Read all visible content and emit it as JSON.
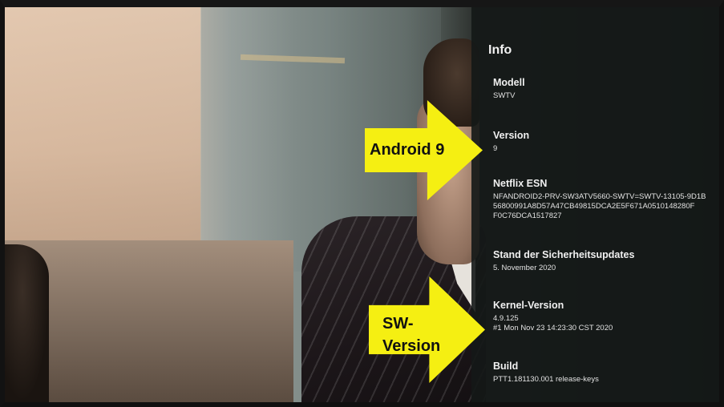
{
  "panel": {
    "title": "Info",
    "items": [
      {
        "label": "Modell",
        "value": "SWTV"
      },
      {
        "label": "Version",
        "value": "9"
      },
      {
        "label": "Netflix ESN",
        "value": "NFANDROID2-PRV-SW3ATV5660-SWTV=SWTV-13105-9D1B\n56800991A8D57A47CB49815DCA2E5F671A0510148280F\nF0C76DCA1517827"
      },
      {
        "label": "Stand der Sicherheitsupdates",
        "value": "5. November 2020"
      },
      {
        "label": "Kernel-Version",
        "value": "4.9.125\n#1 Mon Nov 23 14:23:30 CST 2020"
      },
      {
        "label": "Build",
        "value": "PTT1.181130.001 release-keys"
      }
    ]
  },
  "annotations": {
    "arrow1_text": "Android 9",
    "arrow2_line1": "SW-",
    "arrow2_line2": "Version",
    "arrow_color": "#f5ef12"
  }
}
